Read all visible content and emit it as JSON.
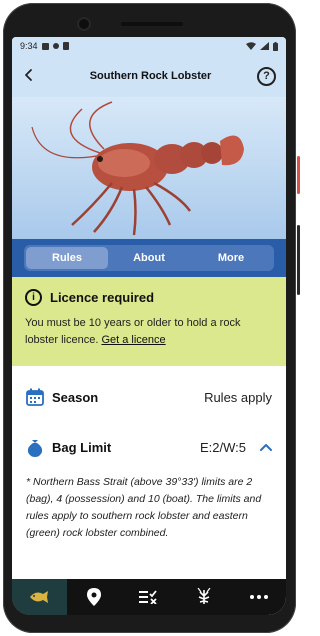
{
  "status_bar": {
    "time": "9:34"
  },
  "header": {
    "title": "Southern Rock Lobster",
    "back_icon": "back-arrow-icon",
    "help_icon": "help-circle-icon"
  },
  "tabs": [
    {
      "label": "Rules",
      "active": true
    },
    {
      "label": "About",
      "active": false
    },
    {
      "label": "More",
      "active": false
    }
  ],
  "licence": {
    "title": "Licence required",
    "body": "You must be 10 years or older to hold a rock lobster licence.",
    "link": "Get a licence",
    "bg_color": "#dbe88d"
  },
  "season": {
    "label": "Season",
    "value": "Rules apply"
  },
  "bag_limit": {
    "label": "Bag Limit",
    "value": "E:2/W:5",
    "detail": "* Northern Bass Strait (above 39°33') limits are 2 (bag), 4 (possession) and 10 (boat). The limits and rules apply to southern rock lobster and eastern (green) rock lobster combined."
  },
  "bottom_nav": [
    {
      "icon": "fish-icon",
      "active": true
    },
    {
      "icon": "location-pin-icon",
      "active": false
    },
    {
      "icon": "checklist-icon",
      "active": false
    },
    {
      "icon": "lobster-icon",
      "active": false
    },
    {
      "icon": "more-dots-icon",
      "active": false
    }
  ],
  "colors": {
    "header_bg": "#cfe3f7",
    "tab_bar_bg": "#2a5da8",
    "accent_blue": "#2a6fc0",
    "nav_bg": "#121212"
  }
}
